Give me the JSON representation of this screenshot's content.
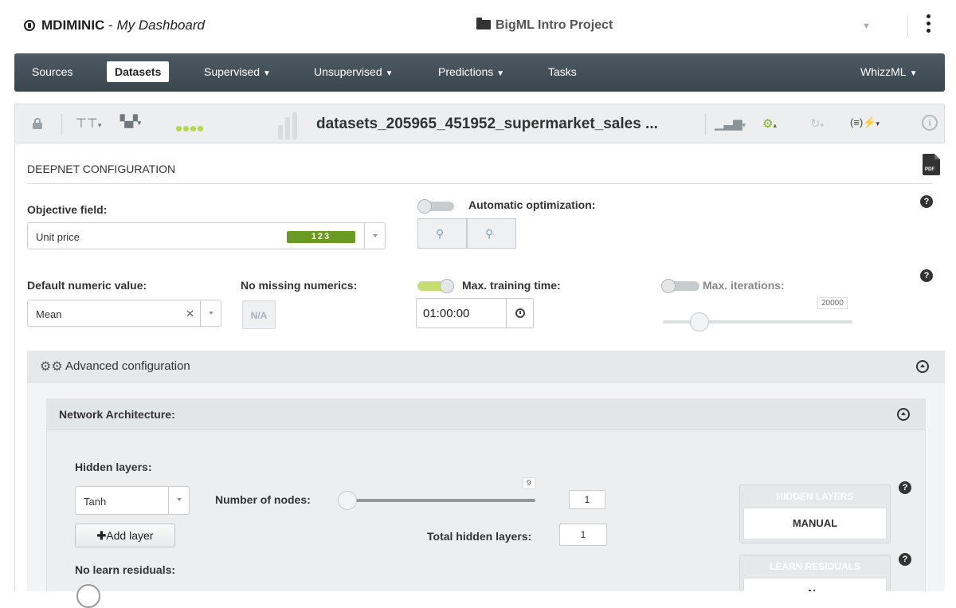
{
  "header": {
    "org": "MDIMINIC",
    "separator": " - ",
    "dashboard": "My Dashboard",
    "project": "BigML Intro Project"
  },
  "nav": {
    "items": [
      {
        "label": "Sources",
        "active": false,
        "caret": false
      },
      {
        "label": "Datasets",
        "active": true,
        "caret": false
      },
      {
        "label": "Supervised",
        "active": false,
        "caret": true
      },
      {
        "label": "Unsupervised",
        "active": false,
        "caret": true
      },
      {
        "label": "Predictions",
        "active": false,
        "caret": true
      },
      {
        "label": "Tasks",
        "active": false,
        "caret": false
      }
    ],
    "right": "WhizzML"
  },
  "toolbar": {
    "dataset_name": "datasets_205965_451952_supermarket_sales ..."
  },
  "config": {
    "title": "DEEPNET CONFIGURATION",
    "pdf_label": "PDF",
    "objective_label": "Objective field:",
    "objective_value": "Unit price",
    "objective_type": "123",
    "auto_opt_label": "Automatic optimization:",
    "auto_opt_on": false,
    "default_numeric_label": "Default numeric value:",
    "default_numeric_value": "Mean",
    "no_missing_label": "No missing numerics:",
    "na_button": "N/A",
    "max_time_label": "Max. training time:",
    "max_time_on": true,
    "max_time_value": "01:00:00",
    "max_iter_label": "Max. iterations:",
    "max_iter_on": false,
    "max_iter_value": "20000"
  },
  "advanced": {
    "title": "Advanced configuration",
    "network": {
      "title": "Network Architecture:",
      "hidden_layers_label": "Hidden layers:",
      "activation_value": "Tanh",
      "nodes_label": "Number of nodes:",
      "nodes_max_value": "9",
      "nodes_value": "1",
      "add_layer_label": "Add layer",
      "total_hidden_label": "Total hidden layers:",
      "total_hidden_value": "1",
      "no_learn_residuals_label": "No learn residuals:",
      "hidden_layers_card_title": "HIDDEN LAYERS",
      "hidden_layers_card_value": "MANUAL",
      "learn_residuals_card_title": "LEARN RESIDUALS",
      "learn_residuals_card_value": "No"
    }
  },
  "help_glyph": "?",
  "colors": {
    "nav_bg": "#434f57",
    "accent_green": "#7fb01f",
    "badge_green": "#6a9a26",
    "card_head": "#e6e8e9"
  }
}
